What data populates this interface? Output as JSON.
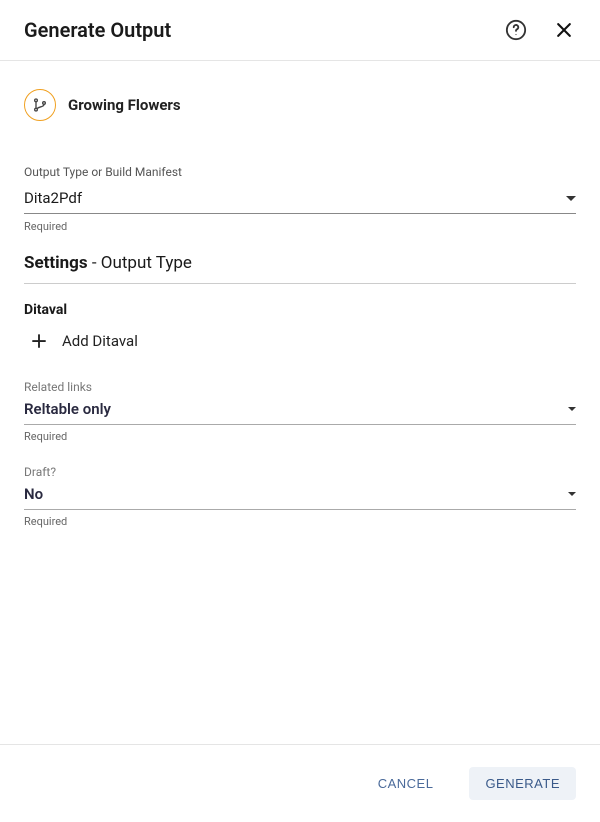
{
  "header": {
    "title": "Generate Output"
  },
  "project": {
    "name": "Growing Flowers"
  },
  "fields": {
    "outputType": {
      "label": "Output Type or Build Manifest",
      "value": "Dita2Pdf",
      "helper": "Required"
    }
  },
  "section": {
    "title_strong": "Settings",
    "title_separator": " - ",
    "title_rest": "Output Type"
  },
  "ditaval": {
    "heading": "Ditaval",
    "add_label": "Add Ditaval"
  },
  "relatedLinks": {
    "label": "Related links",
    "value": "Reltable only",
    "helper": "Required"
  },
  "draft": {
    "label": "Draft?",
    "value": "No",
    "helper": "Required"
  },
  "footer": {
    "cancel": "CANCEL",
    "generate": "GENERATE"
  }
}
